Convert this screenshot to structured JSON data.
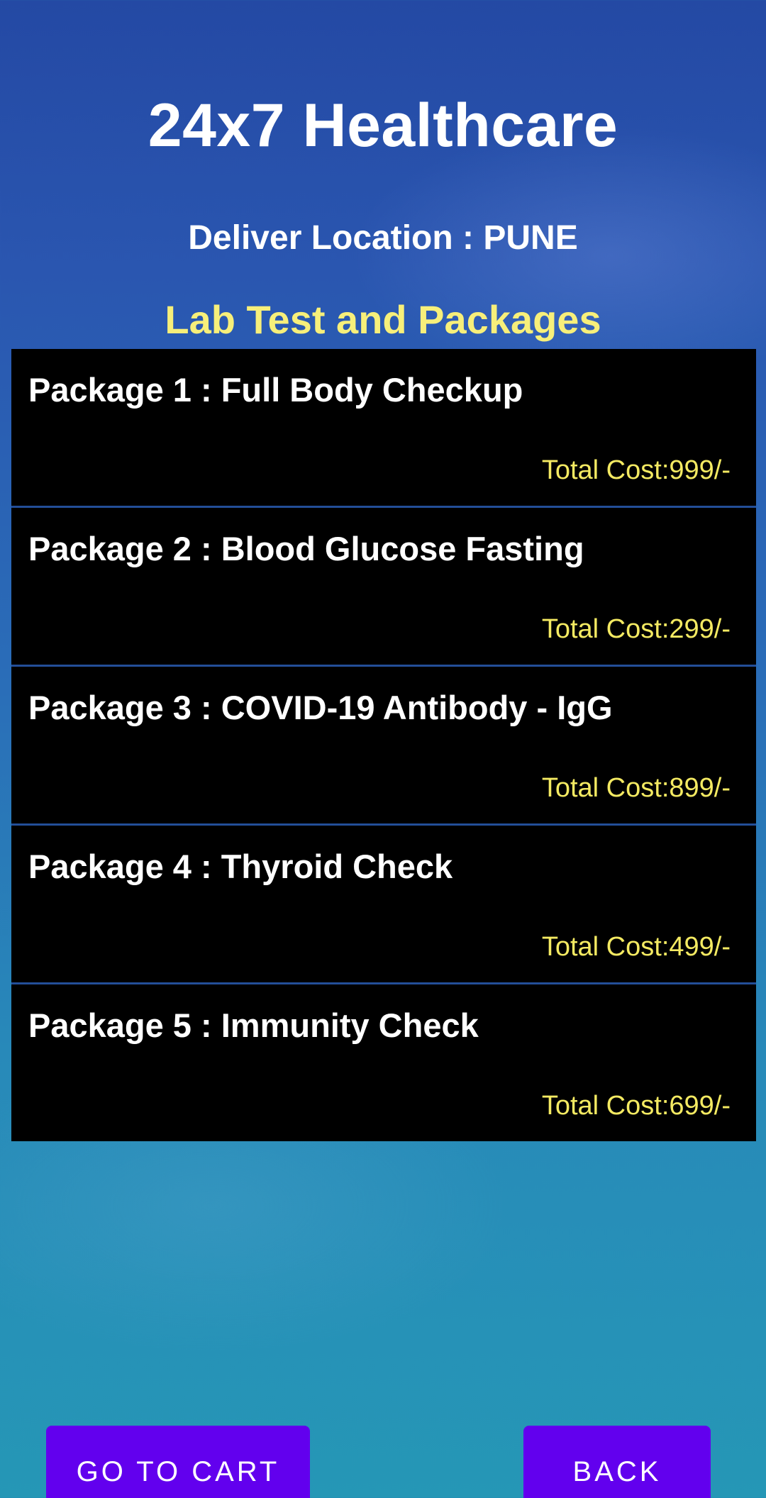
{
  "header": {
    "title": "24x7 Healthcare",
    "location": "Deliver Location : PUNE",
    "section_title": "Lab Test and Packages"
  },
  "packages": [
    {
      "name": "Package 1 : Full Body Checkup",
      "cost": "Total Cost:999/-"
    },
    {
      "name": "Package 2 : Blood Glucose Fasting",
      "cost": "Total Cost:299/-"
    },
    {
      "name": "Package 3 : COVID-19 Antibody - IgG",
      "cost": "Total Cost:899/-"
    },
    {
      "name": "Package 4 : Thyroid Check",
      "cost": "Total Cost:499/-"
    },
    {
      "name": "Package 5 : Immunity Check",
      "cost": "Total Cost:699/-"
    }
  ],
  "actions": {
    "cart_label": "GO TO CART",
    "back_label": "BACK"
  },
  "colors": {
    "accent": "#6200ee",
    "section_title": "#f7ef7a",
    "cost_text": "#f4ea62",
    "list_background": "#000000"
  }
}
